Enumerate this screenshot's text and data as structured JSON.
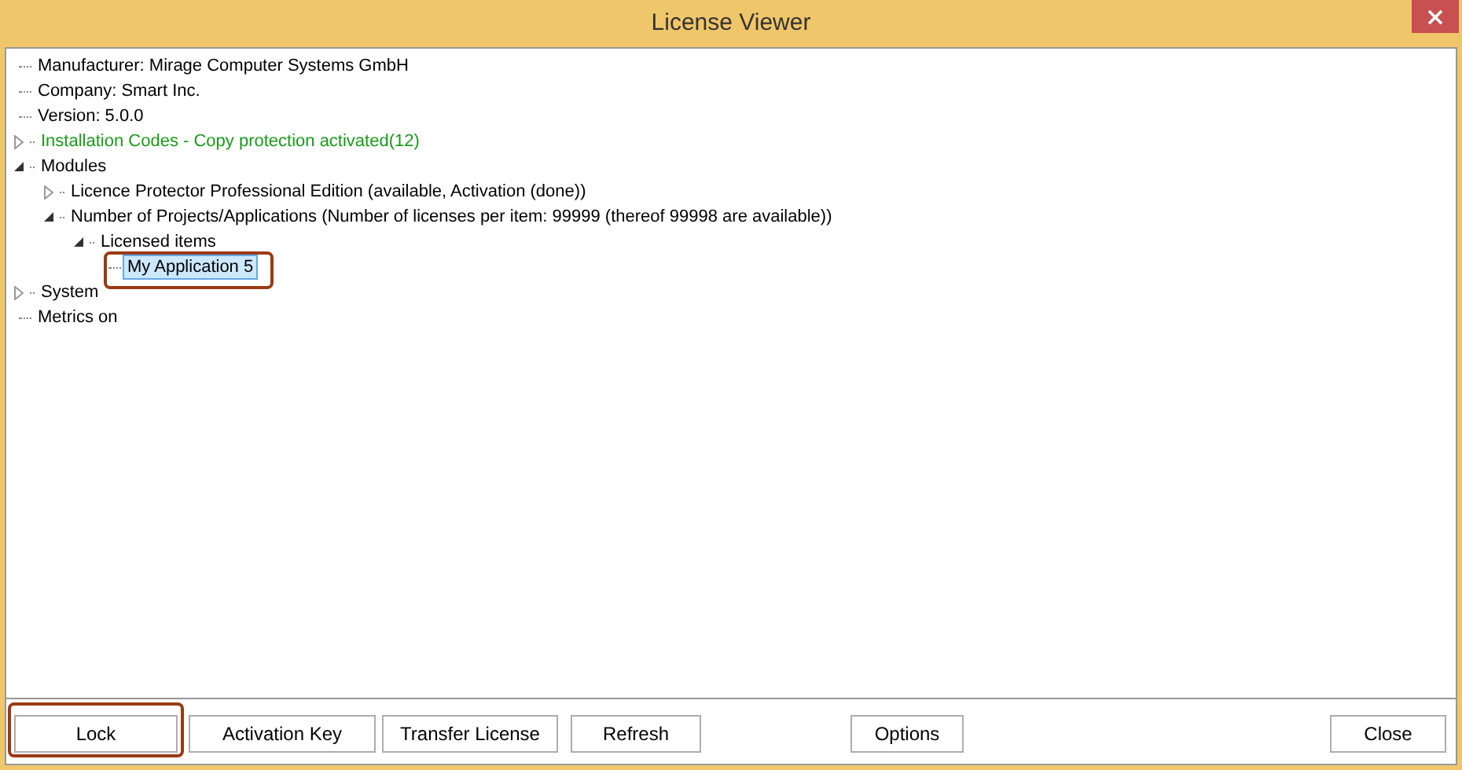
{
  "window": {
    "title": "License Viewer"
  },
  "tree": [
    {
      "label": "Manufacturer: Mirage Computer Systems GmbH"
    },
    {
      "label": "Company: Smart Inc."
    },
    {
      "label": "Version: 5.0.0"
    },
    {
      "label": "Installation Codes - Copy protection activated(12)",
      "expanded": false,
      "color": "#1a9a1a"
    },
    {
      "label": "Modules",
      "expanded": true,
      "children": [
        {
          "label": "Licence Protector Professional Edition (available, Activation (done))",
          "expanded": false
        },
        {
          "label": "Number of Projects/Applications (Number of licenses per item: 99999 (thereof 99998 are available))",
          "expanded": true,
          "children": [
            {
              "label": "Licensed items",
              "expanded": true,
              "children": [
                {
                  "label": "My Application 5",
                  "selected": true,
                  "highlighted": true
                }
              ]
            }
          ]
        }
      ]
    },
    {
      "label": "System",
      "expanded": false
    },
    {
      "label": "Metrics on"
    }
  ],
  "buttons": [
    {
      "label": "Lock",
      "highlighted": true
    },
    {
      "label": "Activation Key",
      "highlighted": false
    },
    {
      "label": "Transfer License",
      "highlighted": false
    },
    {
      "label": "Refresh",
      "highlighted": false
    },
    {
      "label": "Options",
      "highlighted": false
    },
    {
      "label": "Close",
      "highlighted": false
    }
  ]
}
